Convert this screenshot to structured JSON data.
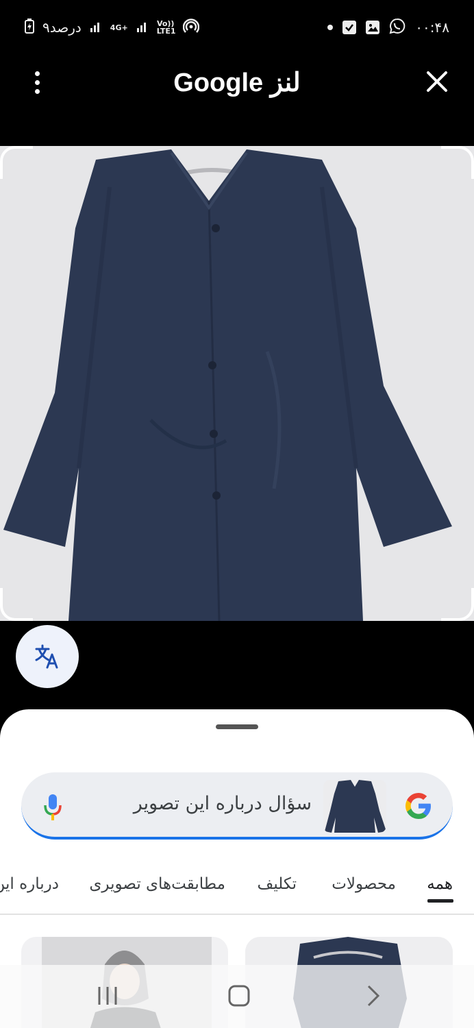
{
  "status_bar": {
    "time": "۰۰:۴۸",
    "battery": "۹درصد",
    "network_4g": "4G+",
    "volte": "Vo)) LTE1"
  },
  "header": {
    "title": "لنز Google"
  },
  "icons": {
    "more": "more-vert-icon",
    "close": "close-icon",
    "translate": "translate-icon",
    "google": "google-g-icon",
    "mic": "mic-icon"
  },
  "search": {
    "placeholder": "سؤال درباره این تصویر"
  },
  "tabs": [
    {
      "label": "همه",
      "active": true
    },
    {
      "label": "محصولات",
      "active": false
    },
    {
      "label": "تکلیف",
      "active": false
    },
    {
      "label": "مطابقت‌های تصویری",
      "active": false
    },
    {
      "label": "درباره این",
      "active": false
    }
  ],
  "colors": {
    "accent": "#1a73e8",
    "garment": "#2a3650"
  }
}
